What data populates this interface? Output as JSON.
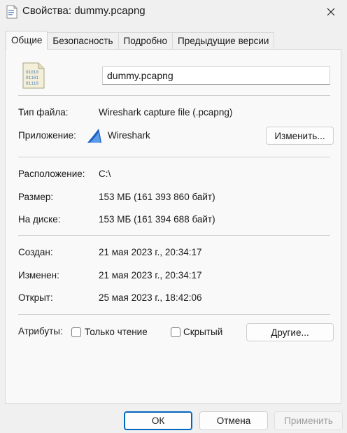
{
  "window": {
    "title": "Свойства: dummy.pcapng",
    "close_icon": "close-icon"
  },
  "tabs": [
    {
      "label": "Общие",
      "active": true
    },
    {
      "label": "Безопасность",
      "active": false
    },
    {
      "label": "Подробно",
      "active": false
    },
    {
      "label": "Предыдущие версии",
      "active": false
    }
  ],
  "general": {
    "file_icon": "binary-file-icon",
    "file_name": "dummy.pcapng",
    "type_label": "Тип файла:",
    "type_value": "Wireshark capture file (.pcapng)",
    "app_label": "Приложение:",
    "app_icon": "wireshark-fin-icon",
    "app_value": "Wireshark",
    "change_button": "Изменить...",
    "location_label": "Расположение:",
    "location_value": "C:\\",
    "size_label": "Размер:",
    "size_value": "153 МБ (161 393 860 байт)",
    "disk_label": "На диске:",
    "disk_value": "153 МБ (161 394 688 байт)",
    "created_label": "Создан:",
    "created_value": "21 мая 2023 г., 20:34:17",
    "modified_label": "Изменен:",
    "modified_value": "21 мая 2023 г., 20:34:17",
    "opened_label": "Открыт:",
    "opened_value": "25 мая 2023 г., 18:42:06",
    "attributes_label": "Атрибуты:",
    "readonly_label": "Только чтение",
    "readonly_checked": false,
    "hidden_label": "Скрытый",
    "hidden_checked": false,
    "other_button": "Другие..."
  },
  "footer": {
    "ok": "ОК",
    "cancel": "Отмена",
    "apply": "Применить"
  },
  "colors": {
    "accent": "#0067c0",
    "wireshark_blue": "#1e62c4",
    "background": "#f0f0f0",
    "panel": "#f9f9f9"
  }
}
